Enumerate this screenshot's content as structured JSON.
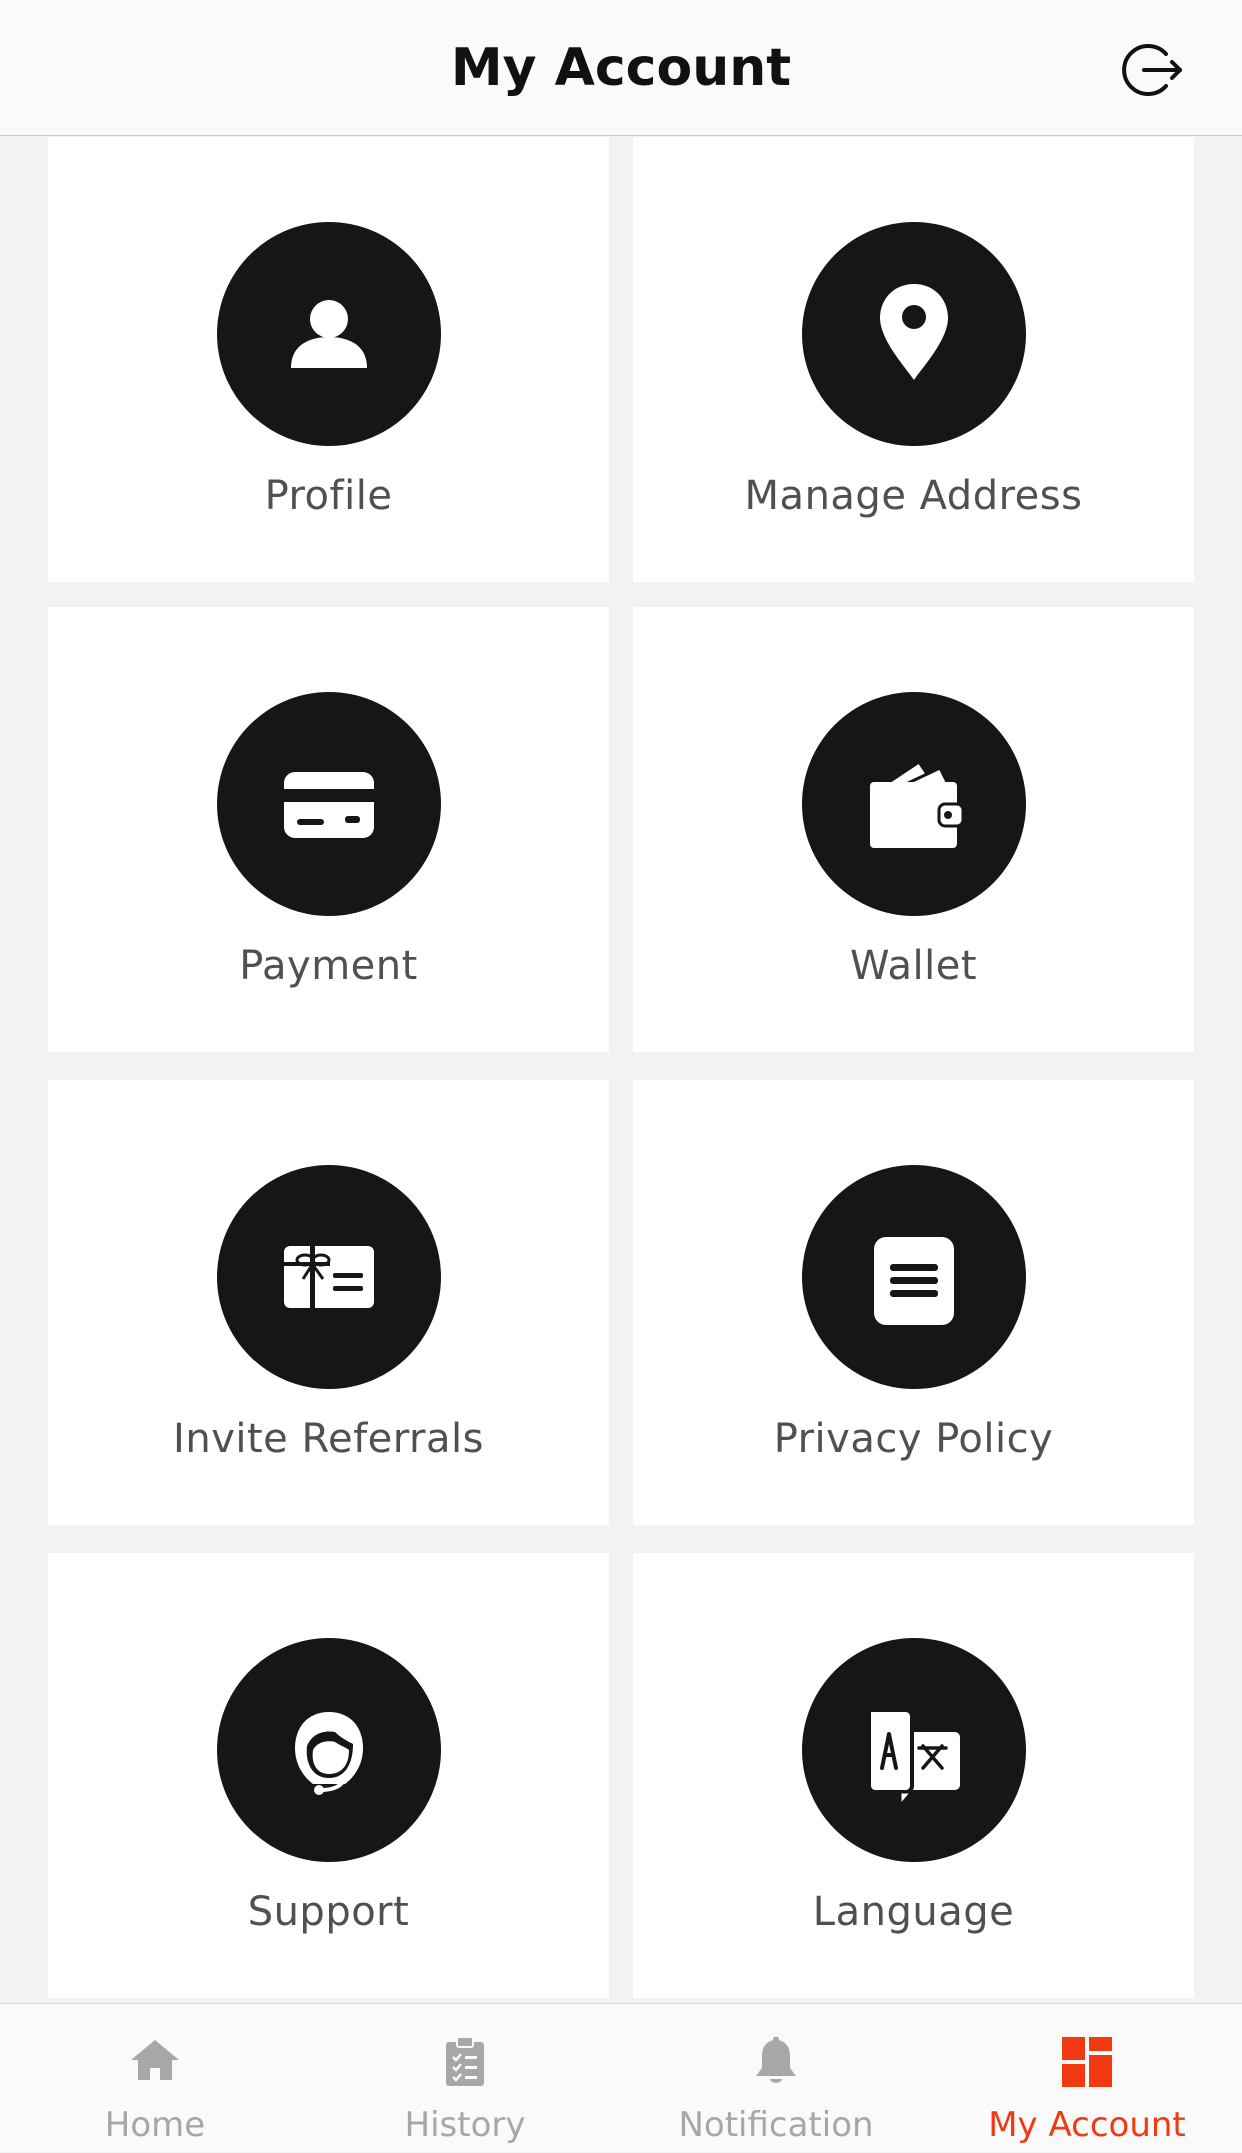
{
  "header": {
    "title": "My Account",
    "logout_icon": "logout-icon"
  },
  "tiles": [
    {
      "label": "Profile",
      "icon": "person-icon"
    },
    {
      "label": "Manage Address",
      "icon": "location-pin-icon"
    },
    {
      "label": "Payment",
      "icon": "credit-card-icon"
    },
    {
      "label": "Wallet",
      "icon": "wallet-icon"
    },
    {
      "label": "Invite Referrals",
      "icon": "gift-card-icon"
    },
    {
      "label": "Privacy Policy",
      "icon": "document-icon"
    },
    {
      "label": "Support",
      "icon": "headset-icon"
    },
    {
      "label": "Language",
      "icon": "translate-icon"
    }
  ],
  "tabbar": {
    "items": [
      {
        "label": "Home",
        "icon": "home-icon"
      },
      {
        "label": "History",
        "icon": "clipboard-icon"
      },
      {
        "label": "Notification",
        "icon": "bell-icon"
      },
      {
        "label": "My Account",
        "icon": "grid-icon"
      }
    ],
    "active_index": 3
  },
  "colors": {
    "accent": "#f23a12",
    "icon_circle": "#161616",
    "inactive_tab": "#a7a7a7",
    "label": "#505050",
    "background": "#f2f2f5"
  }
}
